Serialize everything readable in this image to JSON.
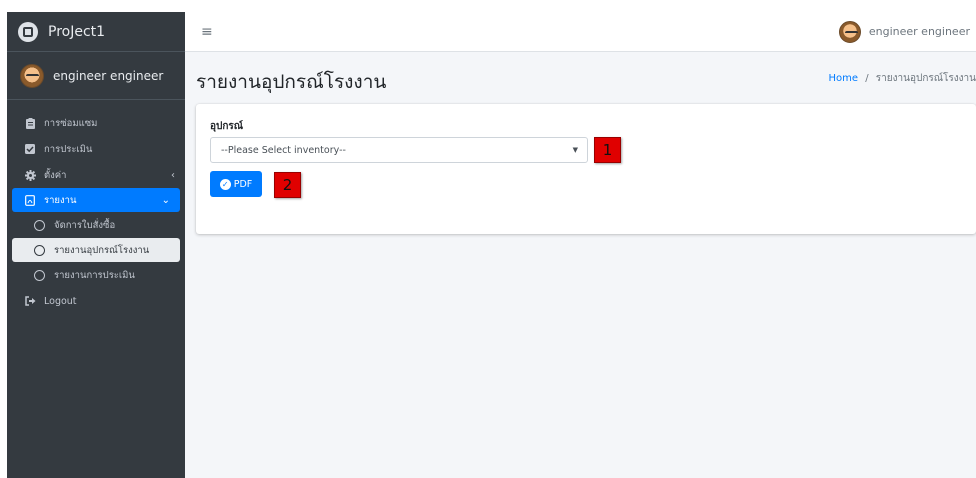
{
  "brand": {
    "title": "ProJect1"
  },
  "user": {
    "name": "engineer engineer"
  },
  "sidebar": {
    "items": [
      {
        "label": "การซ่อมแซม",
        "icon": "clipboard-icon"
      },
      {
        "label": "การประเมิน",
        "icon": "check-square-icon"
      },
      {
        "label": "ตั้งค่า",
        "icon": "gear-icon"
      },
      {
        "label": "รายงาน",
        "icon": "file-pdf-icon"
      },
      {
        "label": "Logout",
        "icon": "sign-out-icon"
      }
    ],
    "subitems": [
      {
        "label": "จัดการใบสั่งซื้อ"
      },
      {
        "label": "รายงานอุปกรณ์โรงงาน"
      },
      {
        "label": "รายงานการประเมิน"
      }
    ]
  },
  "header": {
    "menu_icon": "≡"
  },
  "main": {
    "title": "รายงานอุปกรณ์โรงงาน",
    "breadcrumb": {
      "home": "Home",
      "separator": "/",
      "current": "รายงานอุปกรณ์โรงงาน"
    },
    "form": {
      "label": "อุปกรณ์",
      "select_value": "--Please Select inventory--",
      "pdf_label": "PDF"
    },
    "annotations": {
      "one": "1",
      "two": "2"
    }
  },
  "colors": {
    "sidebar_bg": "#343a40",
    "accent": "#007bff",
    "content_bg": "#f4f6f9",
    "annotation": "#e00000"
  }
}
